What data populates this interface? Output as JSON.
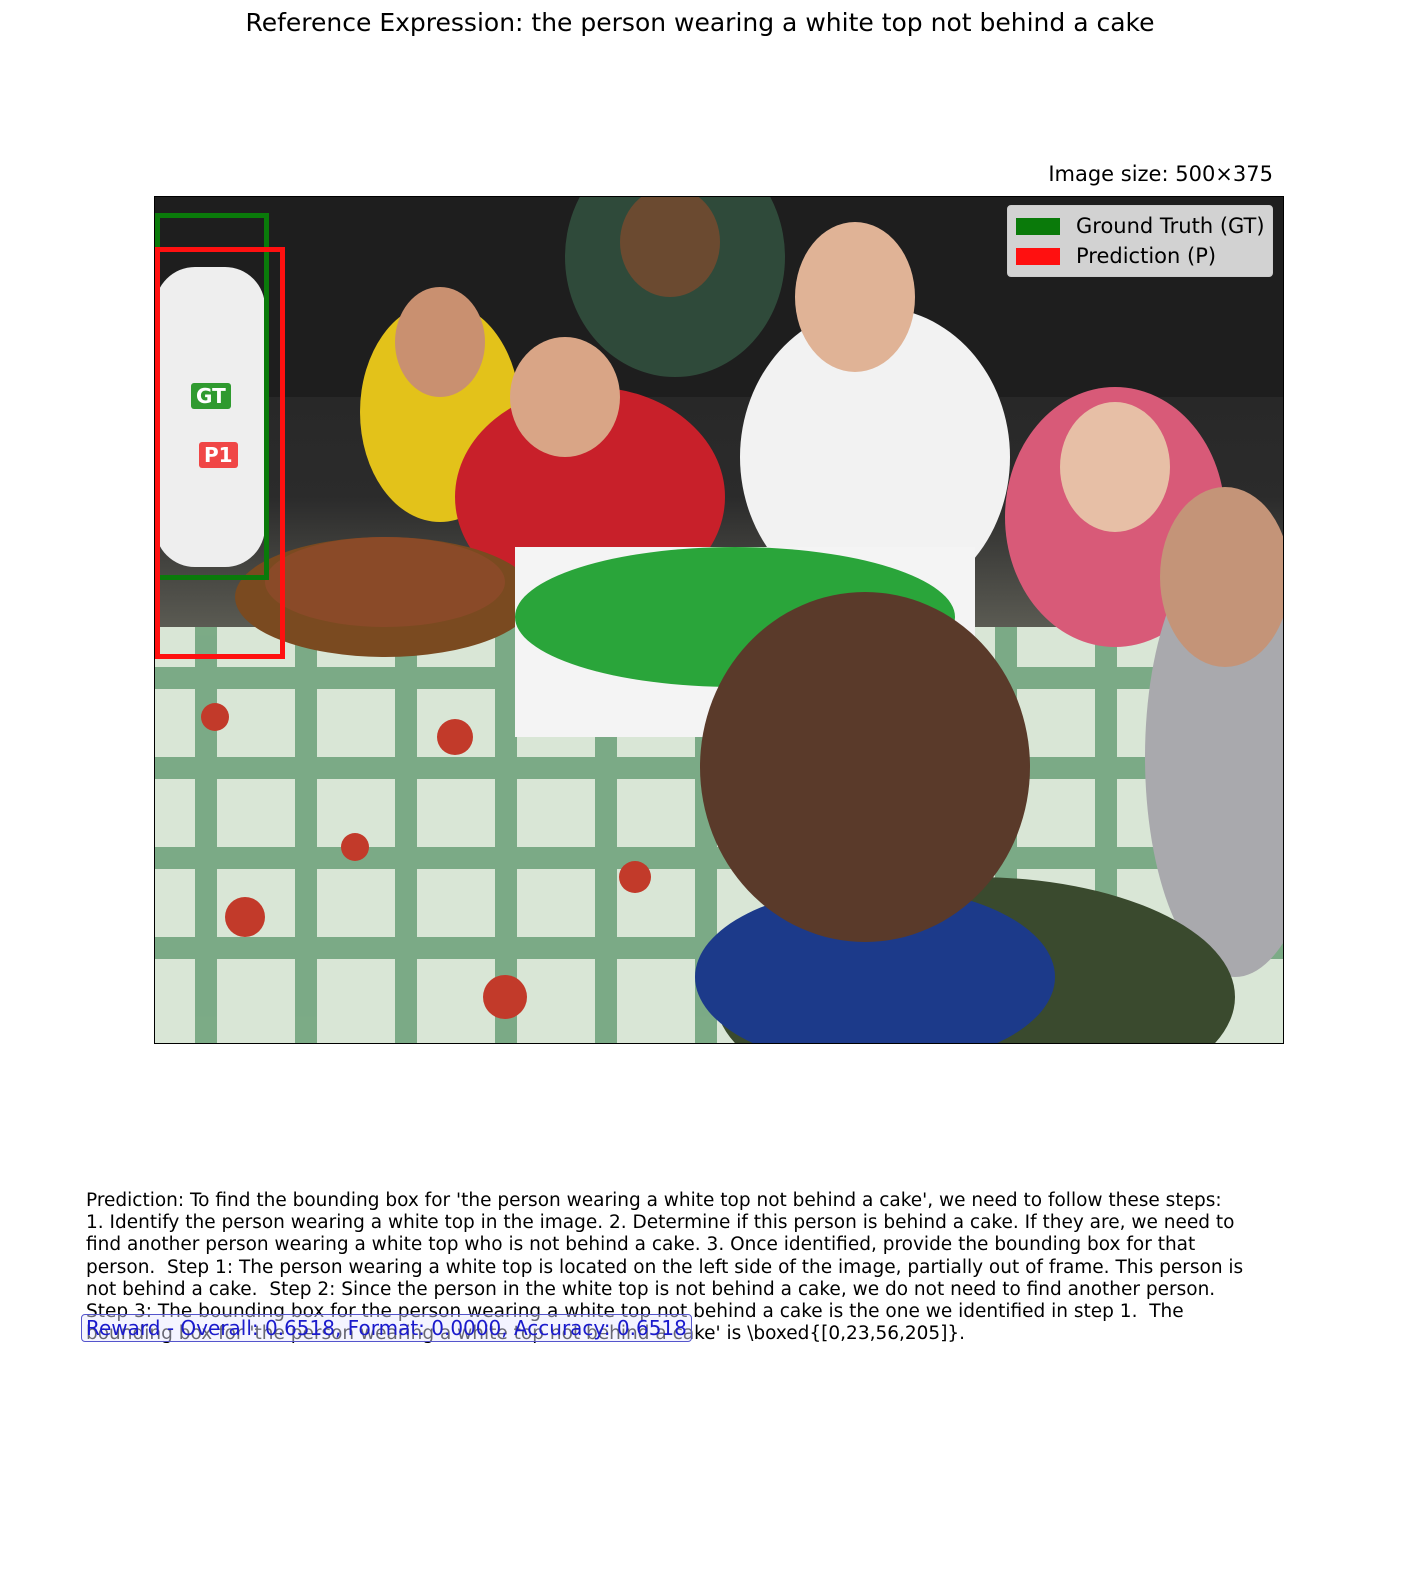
{
  "title": "Reference Expression: the person wearing a white top not behind a cake",
  "image_size_label": "Image size: 500×375",
  "legend": {
    "ground_truth": "Ground Truth (GT)",
    "prediction": "Prediction (P)"
  },
  "box_tags": {
    "gt": "GT",
    "prediction": "P1"
  },
  "colors": {
    "ground_truth": "#0a7a0a",
    "prediction": "#ff1010",
    "reward_text": "#1a1acc"
  },
  "prediction_text": "Prediction: To find the bounding box for 'the person wearing a white top not behind a cake', we need to follow these steps:  1. Identify the person wearing a white top in the image. 2. Determine if this person is behind a cake. If they are, we need to find another person wearing a white top who is not behind a cake. 3. Once identified, provide the bounding box for that person.  Step 1: The person wearing a white top is located on the left side of the image, partially out of frame. This person is not behind a cake.  Step 2: Since the person in the white top is not behind a cake, we do not need to find another person.  Step 3: The bounding box for the person wearing a white top not behind a cake is the one we identified in step 1.  The bounding box for 'the person wearing a white top not behind a cake' is \\boxed{[0,23,56,205]}.",
  "reward_text": "Reward - Overall: 0.6518, Format: 0.0000, Accuracy: 0.6518"
}
